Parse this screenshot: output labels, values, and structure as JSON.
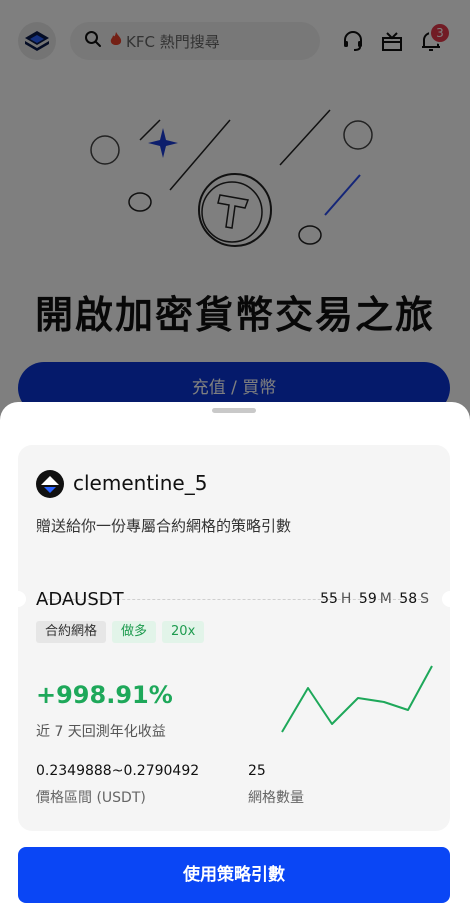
{
  "topbar": {
    "search_placeholder": "KFC 熱門搜尋",
    "notification_count": "3"
  },
  "hero": {
    "title": "開啟加密貨幣交易之旅",
    "topup_label": "充值 / 買幣"
  },
  "sheet": {
    "username": "clementine_5",
    "gift_text": "贈送給你一份專屬合約網格的策略引數",
    "pair": "ADAUSDT",
    "countdown": {
      "h": "55",
      "h_unit": "H",
      "m": "59",
      "m_unit": "M",
      "s": "58",
      "s_unit": "S"
    },
    "tags": [
      "合約網格",
      "做多",
      "20x"
    ],
    "pnl": "+998.91%",
    "pnl_label": "近 7 天回測年化收益",
    "price_range": "0.2349888~0.2790492",
    "price_range_label": "價格區間 (USDT)",
    "grid_count": "25",
    "grid_count_label": "網格數量",
    "cta_label": "使用策略引數"
  },
  "colors": {
    "accent_blue": "#0a46f5",
    "profit_green": "#1ea85a",
    "badge_red": "#e4394a"
  },
  "icons": [
    "logo-icon",
    "search-icon",
    "fire-icon",
    "headset-icon",
    "gift-box-icon",
    "bell-icon"
  ]
}
